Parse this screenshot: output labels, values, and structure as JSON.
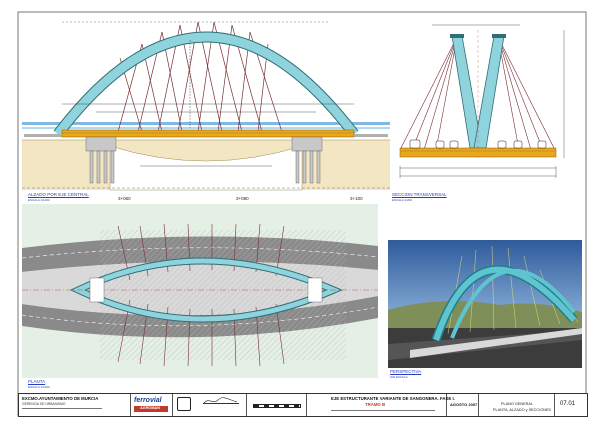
{
  "views": {
    "elevation": {
      "title": "ALZADO POR EJE CENTRAL",
      "scale": "ESCALA 1/1000"
    },
    "section": {
      "title": "SECCION TRANSVERSAL",
      "scale": "ESCALA 1/200"
    },
    "plan": {
      "title": "PLANTA",
      "scale": "ESCALA 1/1000"
    },
    "perspective": {
      "title": "PERSPECTIVA",
      "scale": "SIN ESCALA"
    }
  },
  "chainages": [
    "3+060",
    "3+080",
    "3+100"
  ],
  "title_block": {
    "client": "EXCMO.AYUNTAMIENTO DE MURCIA",
    "client_sub": "GERENCIA DE URBANISMO",
    "contractor": "ferrovial",
    "contractor_sub": "AGROMAN",
    "project": "EJE ESTRUCTURANTE VARIANTE DE SANGONERA. FASE I.",
    "section": "TRAMO B",
    "date": "AGOSTO 2007",
    "plan_title": "PLANO GENERAL",
    "plan_subtitle": "PLANTA, ALZADO y SECCIONES",
    "sheet_number": "07.01"
  },
  "colors": {
    "arch": "#8fd3dc",
    "deck": "#e8a81e",
    "ground": "#f3e6c3",
    "hanger": "#7a2f35",
    "road": "#8a8a8a",
    "annotation": "#2a3fbf"
  }
}
